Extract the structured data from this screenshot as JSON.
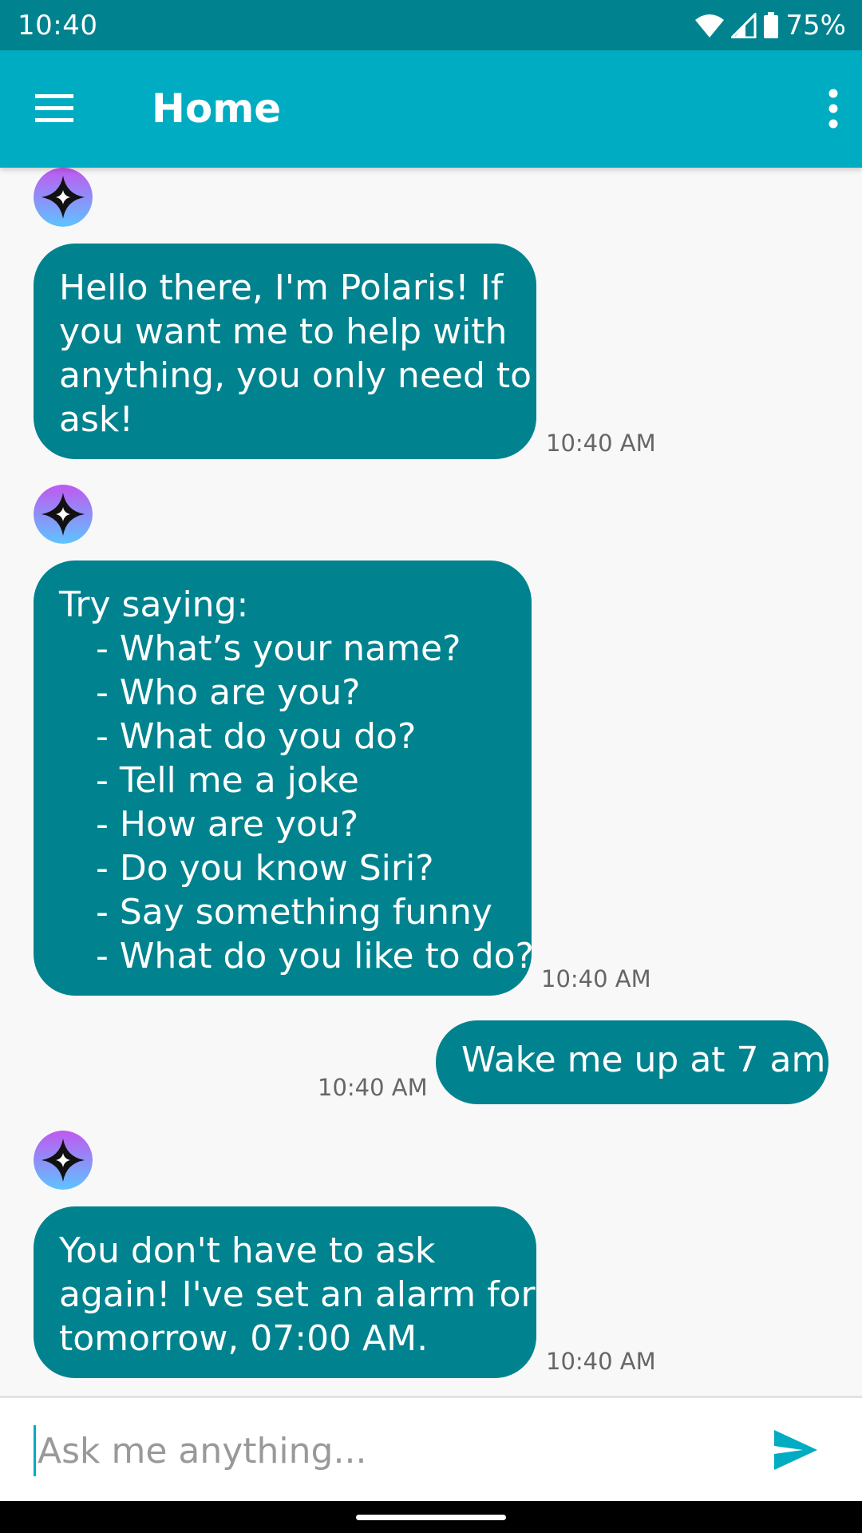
{
  "status_bar": {
    "time": "10:40",
    "battery_percent": "75%",
    "icons": [
      "wifi-icon",
      "cell-signal-icon",
      "battery-icon"
    ]
  },
  "app_bar": {
    "title": "Home",
    "menu_icon": "hamburger-menu-icon",
    "overflow_icon": "more-vert-icon"
  },
  "messages": [
    {
      "sender": "bot",
      "lines": [
        "Hello there, I'm Polaris! If",
        "you want me to help with",
        "anything, you only need to",
        "ask!"
      ],
      "time": "10:40 AM"
    },
    {
      "sender": "bot",
      "intro": "Try saying:",
      "suggestions": [
        "- What’s your name?",
        "- Who are you?",
        "- What do you do?",
        "- Tell me a joke",
        "- How are you?",
        "- Do you know Siri?",
        "- Say something funny",
        "- What do you like to do?"
      ],
      "time": "10:40 AM"
    },
    {
      "sender": "user",
      "text": "Wake me up at 7 am",
      "time": "10:40 AM"
    },
    {
      "sender": "bot",
      "lines": [
        "You don't have to ask",
        "again! I've set an alarm for",
        "tomorrow, 07:00 AM."
      ],
      "time": "10:40 AM"
    }
  ],
  "input": {
    "placeholder": "Ask me anything...",
    "value": "",
    "send_icon": "send-icon"
  },
  "colors": {
    "status_bar": "#00838f",
    "app_bar": "#00acc1",
    "bubble": "#00838f",
    "background": "#f8f8f8"
  }
}
